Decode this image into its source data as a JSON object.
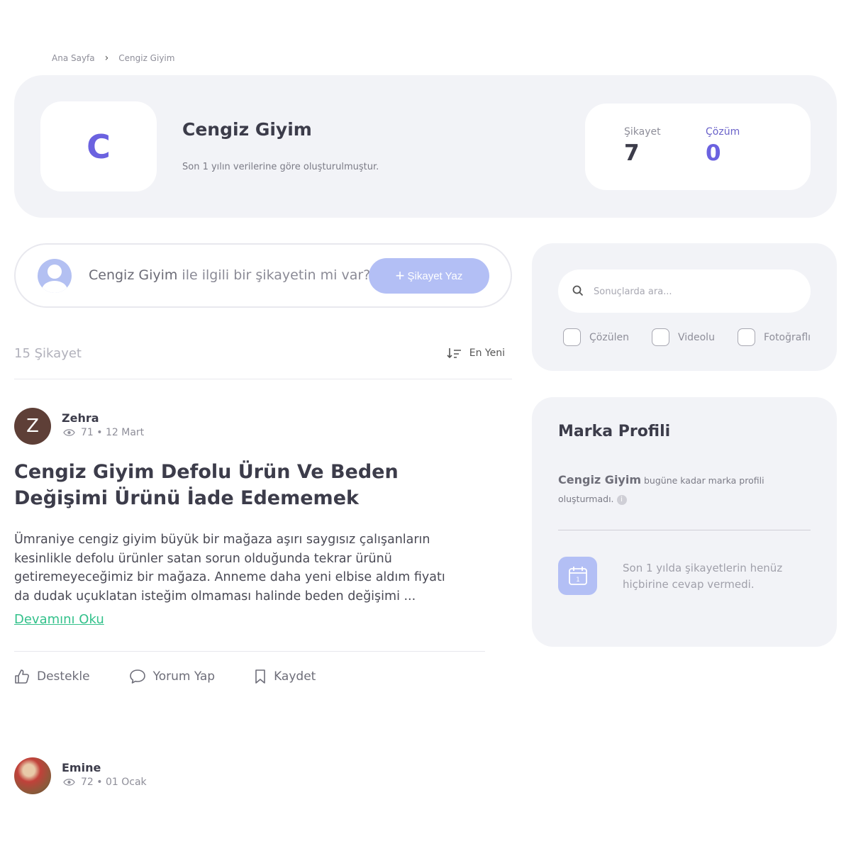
{
  "breadcrumb": {
    "home": "Ana Sayfa",
    "current": "Cengiz Giyim"
  },
  "brand": {
    "logo_letter": "C",
    "name": "Cengiz Giyim",
    "note": "Son 1 yılın verilerine göre oluşturulmuştur.",
    "stats": {
      "complaint_label": "Şikayet",
      "complaint_value": "7",
      "solution_label": "Çözüm",
      "solution_value": "0"
    }
  },
  "write": {
    "brand": "Cengiz Giyim",
    "prompt": " ile ilgili bir şikayetin mi var?",
    "button_label": "Şikayet Yaz"
  },
  "list": {
    "count": "15 Şikayet",
    "sort_label": "En Yeni"
  },
  "complaints": [
    {
      "avatar_letter": "Z",
      "author": "Zehra",
      "views": "71",
      "date": "12 Mart",
      "title": "Cengiz Giyim Defolu Ürün Ve Beden Değişimi Ürünü İade Edememek",
      "body": "Ümraniye cengiz giyim büyük bir mağaza aşırı saygısız çalışanların kesinlikle defolu ürünler satan sorun olduğunda tekrar ürünü getiremeyeceğimiz bir mağaza. Anneme daha yeni elbise aldım fiyatı da dudak uçuklatan isteğim olmaması halinde beden değişimi ...",
      "read_more": "Devamını Oku",
      "actions": {
        "support": "Destekle",
        "comment": "Yorum Yap",
        "save": "Kaydet"
      }
    },
    {
      "author": "Emine",
      "views": "72",
      "date": "01 Ocak"
    }
  ],
  "search": {
    "placeholder": "Sonuçlarda ara...",
    "filters": [
      "Çözülen",
      "Videolu",
      "Fotoğraflı"
    ]
  },
  "profile": {
    "title": "Marka Profili",
    "brand": "Cengiz Giyim",
    "text": " bugüne kadar marka profili oluşturmadı.",
    "info_glyph": "i",
    "calendar_day": "1",
    "reply_note": "Son 1 yılda şikayetlerin henüz hiçbirine cevap vermedi."
  },
  "colors": {
    "accent": "#6b62e0",
    "button": "#b3bff5",
    "link": "#33c18b",
    "panel": "#f2f3f7"
  }
}
